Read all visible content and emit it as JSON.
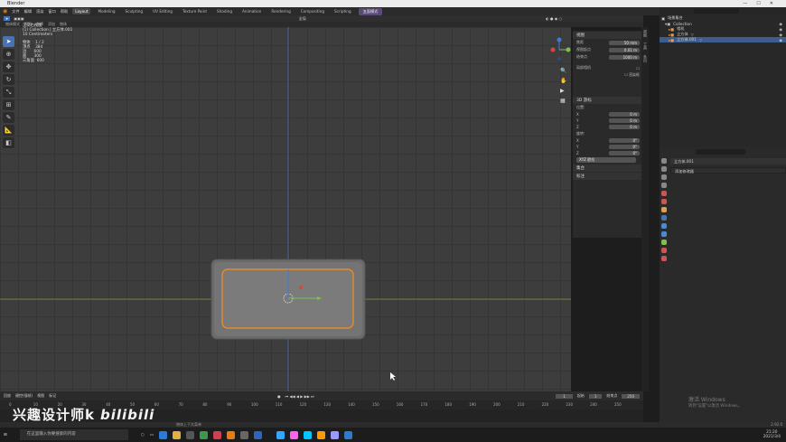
{
  "window": {
    "title": "Blender"
  },
  "topbar": {
    "menus": [
      "文件",
      "编辑",
      "渲染",
      "窗口",
      "帮助"
    ],
    "tabs": [
      "Layout",
      "Modeling",
      "Sculpting",
      "UV Editing",
      "Texture Paint",
      "Shading",
      "Animation",
      "Rendering",
      "Compositing",
      "Scripting"
    ],
    "active_tab": "Layout",
    "right_button": "五面模式",
    "scene": "Scene",
    "view_layer": "View Layer"
  },
  "viewport_header": {
    "mode": "物体模式",
    "menus": [
      "视图",
      "选择",
      "添加",
      "物体"
    ],
    "transform": "全局"
  },
  "viewport_info": {
    "view": "正交右视图",
    "collection": "(1) Collection | 立方体.001",
    "scale": "10 Centimeters",
    "stats": [
      {
        "label": "物体",
        "value": "1 / 2"
      },
      {
        "label": "顶点",
        "value": "384"
      },
      {
        "label": "边",
        "value": "600"
      },
      {
        "label": "面",
        "value": "300"
      },
      {
        "label": "三角面",
        "value": "600"
      }
    ]
  },
  "n_panel": {
    "view_header": "视图",
    "focal_label": "焦距",
    "focal_value": "50 mm",
    "clip_start_label": "视图起点",
    "clip_start_value": "0.01 m",
    "clip_end_label": "结束点",
    "clip_end_value": "1000 m",
    "local_camera": "局部相机",
    "render_region": "渲染框",
    "cursor_header": "3D 游标",
    "location_header": "位置:",
    "loc": [
      {
        "axis": "X",
        "value": "0 m"
      },
      {
        "axis": "Y",
        "value": "0 m"
      },
      {
        "axis": "Z",
        "value": "0 m"
      }
    ],
    "rotation_header": "旋转:",
    "rot": [
      {
        "axis": "X",
        "value": "0°"
      },
      {
        "axis": "Y",
        "value": "0°"
      },
      {
        "axis": "Z",
        "value": "0°"
      }
    ],
    "rot_mode": "XYZ 欧拉",
    "collections": "集合",
    "annotations": "标注"
  },
  "sidetabs": [
    "视图",
    "工具",
    "条目"
  ],
  "outliner": {
    "title": "场景集合",
    "collection": "Collection",
    "items": [
      "相机",
      "立方体",
      "立方体.001"
    ],
    "selected": 2
  },
  "properties": {
    "object_name": "立方体.001",
    "dropdown": "添加修改器"
  },
  "timeline": {
    "menus": [
      "回放",
      "键控(插帧)",
      "视图",
      "标记"
    ],
    "current_frame": "1",
    "start_label": "起始",
    "start": "1",
    "end_label": "结束点",
    "end": "250",
    "ticks": [
      "0",
      "10",
      "20",
      "30",
      "40",
      "50",
      "60",
      "70",
      "80",
      "90",
      "100",
      "110",
      "120",
      "130",
      "140",
      "150",
      "160",
      "170",
      "180",
      "190",
      "200",
      "210",
      "220",
      "230",
      "240",
      "250"
    ]
  },
  "statusbar": {
    "left": "选择",
    "mid": "平移视图",
    "right_hint": "物体上下文菜单",
    "version": "2.92.0"
  },
  "taskbar": {
    "search": "在这里输入你要搜索的内容",
    "time": "21:20",
    "date": "2021/3/4"
  },
  "watermark": {
    "text": "兴趣设计师k",
    "logo": "bilibili"
  },
  "activation": {
    "title": "激活 Windows",
    "sub": "转到\"设置\"以激活 Windows。"
  },
  "colors": {
    "selection": "#e68a2e",
    "accent": "#4772b3",
    "x_axis": "#d9453c",
    "y_axis": "#7fc14a",
    "z_axis": "#3f7ad6"
  }
}
